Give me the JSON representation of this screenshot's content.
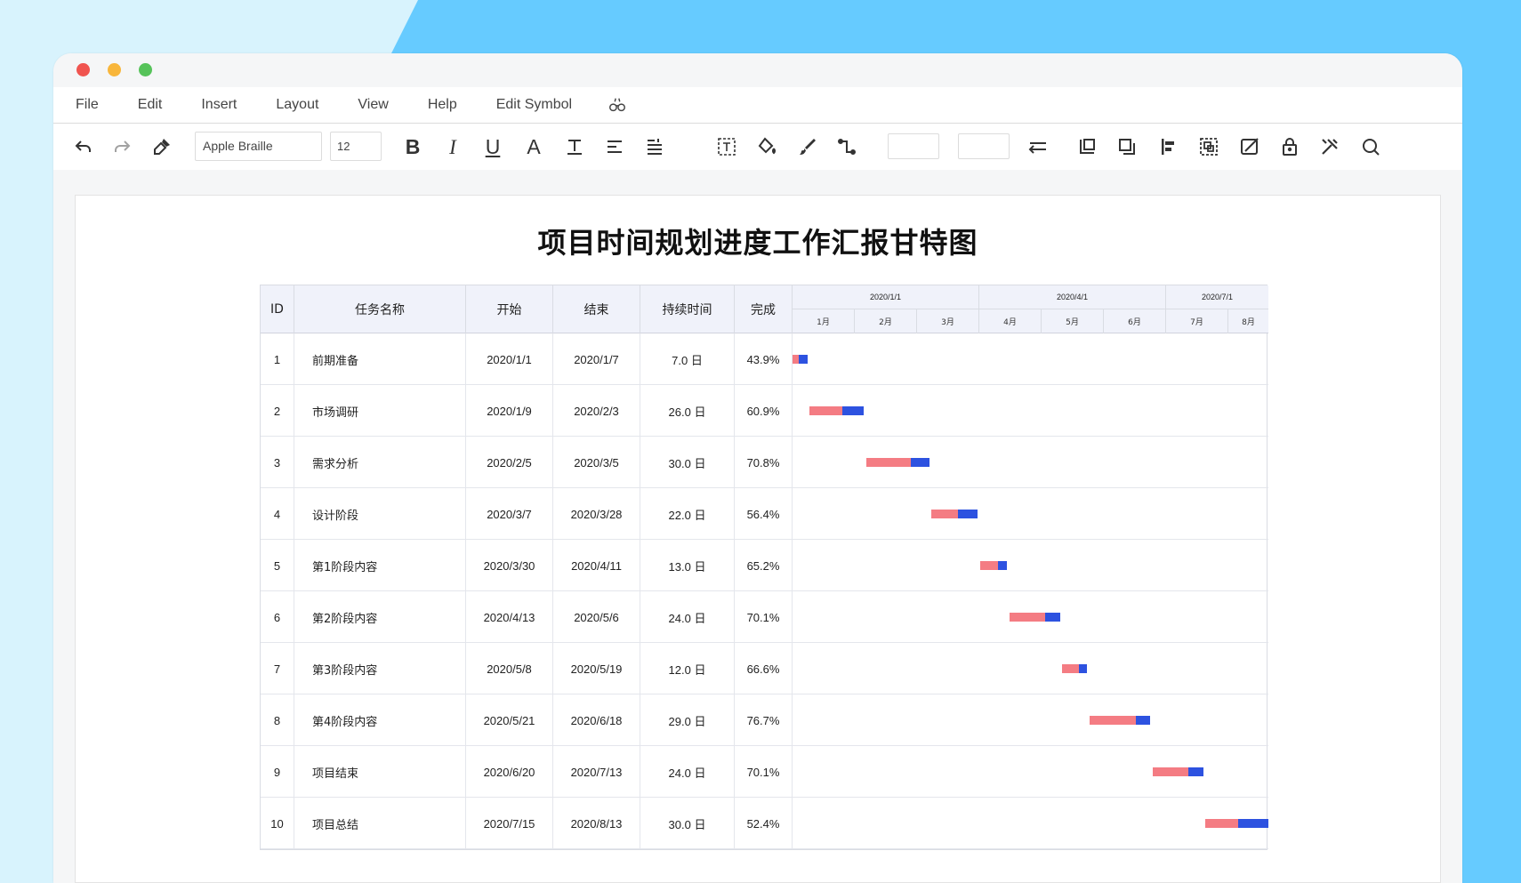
{
  "window": {
    "menu": [
      "File",
      "Edit",
      "Insert",
      "Layout",
      "View",
      "Help",
      "Edit Symbol"
    ]
  },
  "toolbar": {
    "font_name": "Apple Braille",
    "font_size": "12",
    "bold_glyph": "B",
    "italic_glyph": "I",
    "underline_glyph": "U",
    "text_color_glyph": "A"
  },
  "colors": {
    "background_accent": "#66cbff",
    "bar_done": "#f47c83",
    "bar_remaining": "#2d52e0",
    "header_bg": "#f0f2fa"
  },
  "document": {
    "title": "项目时间规划进度工作汇报甘特图",
    "columns": [
      "ID",
      "任务名称",
      "开始",
      "结束",
      "持续时间",
      "完成"
    ],
    "quarters": [
      "2020/1/1",
      "2020/4/1",
      "2020/7/1"
    ],
    "months": [
      "1月",
      "2月",
      "3月",
      "4月",
      "5月",
      "6月",
      "7月",
      "8月"
    ],
    "tasks": [
      {
        "id": "1",
        "name": "前期准备",
        "start": "2020/1/1",
        "end": "2020/1/7",
        "duration": "7.0 日",
        "complete": "43.9%"
      },
      {
        "id": "2",
        "name": "市场调研",
        "start": "2020/1/9",
        "end": "2020/2/3",
        "duration": "26.0 日",
        "complete": "60.9%"
      },
      {
        "id": "3",
        "name": "需求分析",
        "start": "2020/2/5",
        "end": "2020/3/5",
        "duration": "30.0 日",
        "complete": "70.8%"
      },
      {
        "id": "4",
        "name": "设计阶段",
        "start": "2020/3/7",
        "end": "2020/3/28",
        "duration": "22.0 日",
        "complete": "56.4%"
      },
      {
        "id": "5",
        "name": "第1阶段内容",
        "start": "2020/3/30",
        "end": "2020/4/11",
        "duration": "13.0 日",
        "complete": "65.2%"
      },
      {
        "id": "6",
        "name": "第2阶段内容",
        "start": "2020/4/13",
        "end": "2020/5/6",
        "duration": "24.0 日",
        "complete": "70.1%"
      },
      {
        "id": "7",
        "name": "第3阶段内容",
        "start": "2020/5/8",
        "end": "2020/5/19",
        "duration": "12.0 日",
        "complete": "66.6%"
      },
      {
        "id": "8",
        "name": "第4阶段内容",
        "start": "2020/5/21",
        "end": "2020/6/18",
        "duration": "29.0 日",
        "complete": "76.7%"
      },
      {
        "id": "9",
        "name": "项目结束",
        "start": "2020/6/20",
        "end": "2020/7/13",
        "duration": "24.0 日",
        "complete": "70.1%"
      },
      {
        "id": "10",
        "name": "项目总结",
        "start": "2020/7/15",
        "end": "2020/8/13",
        "duration": "30.0 日",
        "complete": "52.4%"
      }
    ]
  }
}
